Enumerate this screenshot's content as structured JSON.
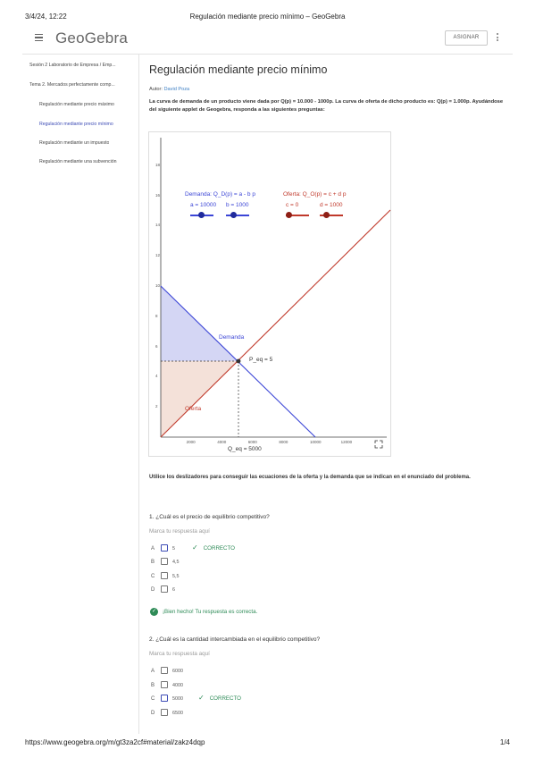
{
  "print": {
    "datetime": "3/4/24, 12:22",
    "title": "Regulación mediante precio mínimo – GeoGebra",
    "url": "https://www.geogebra.org/m/gt3za2cf#material/zakz4dqp",
    "page": "1/4"
  },
  "header": {
    "logo": "GeoGebra",
    "assign_label": "ASIGNAR"
  },
  "sidebar": {
    "items": [
      {
        "label": "Sesión 2 Laboratorio de Empresa / Emp...",
        "level": 0,
        "active": false
      },
      {
        "label": "Tema 2. Mercados perfectamente comp...",
        "level": 0,
        "active": false
      },
      {
        "label": "Regulación mediante precio máximo",
        "level": 1,
        "active": false
      },
      {
        "label": "Regulación mediante precio mínimo",
        "level": 1,
        "active": true
      },
      {
        "label": "Regulación mediante un impuesto",
        "level": 1,
        "active": false
      },
      {
        "label": "Regulación mediante una subvención",
        "level": 1,
        "active": false
      }
    ]
  },
  "main": {
    "title": "Regulación mediante precio mínimo",
    "author_label": "Autor:",
    "author_name": "David Poza",
    "intro": "La curva de demanda de un producto viene dada por Q(p) = 10.000 - 1000p. La curva de oferta de dicho producto es: Q(p) = 1.000p. Ayudándose del siguiente applet de Geogebra, responda a las siguientes preguntas:",
    "instructions": "Utilice los deslizadores para conseguir las ecuaciones de la oferta y la demanda que se indican en el enunciado del problema."
  },
  "applet": {
    "demand_label": "Demanda: Q_D(p) = a - b p",
    "supply_label": "Oferta: Q_O(p) = c + d p",
    "slider_a": "a = 10000",
    "slider_b": "b = 1000",
    "slider_c": "c = 0",
    "slider_d": "d = 1000",
    "curve_demand": "Demanda",
    "curve_supply": "Oferta",
    "peq_label": "P_eq = 5",
    "qeq_label": "Q_eq = 5000",
    "colors": {
      "demand": "#3b45d6",
      "supply": "#c0392b",
      "demand_fill": "#c9ccf1",
      "supply_fill": "#f1d9cf"
    },
    "y_ticks": [
      "18",
      "16",
      "14",
      "12",
      "10",
      "8",
      "6",
      "4",
      "2",
      "0"
    ],
    "x_ticks": [
      "2000",
      "4000",
      "6000",
      "8000",
      "10000",
      "12000"
    ]
  },
  "questions": [
    {
      "title": "1. ¿Cuál es el precio de equilibrio competitivo?",
      "placeholder": "Marca tu respuesta aquí",
      "options": [
        {
          "letter": "A",
          "text": "5",
          "selected": true
        },
        {
          "letter": "B",
          "text": "4,5",
          "selected": false
        },
        {
          "letter": "C",
          "text": "5,5",
          "selected": false
        },
        {
          "letter": "D",
          "text": "6",
          "selected": false
        }
      ],
      "correct_label": "CORRECTO",
      "feedback": "¡Bien hecho! Tu respuesta es correcta."
    },
    {
      "title": "2. ¿Cuál es la cantidad intercambiada en el equilibrio competitivo?",
      "placeholder": "Marca tu respuesta aquí",
      "options": [
        {
          "letter": "A",
          "text": "6000",
          "selected": false
        },
        {
          "letter": "B",
          "text": "4000",
          "selected": false
        },
        {
          "letter": "C",
          "text": "5000",
          "selected": true
        },
        {
          "letter": "D",
          "text": "6500",
          "selected": false
        }
      ],
      "correct_label": "CORRECTO"
    }
  ]
}
